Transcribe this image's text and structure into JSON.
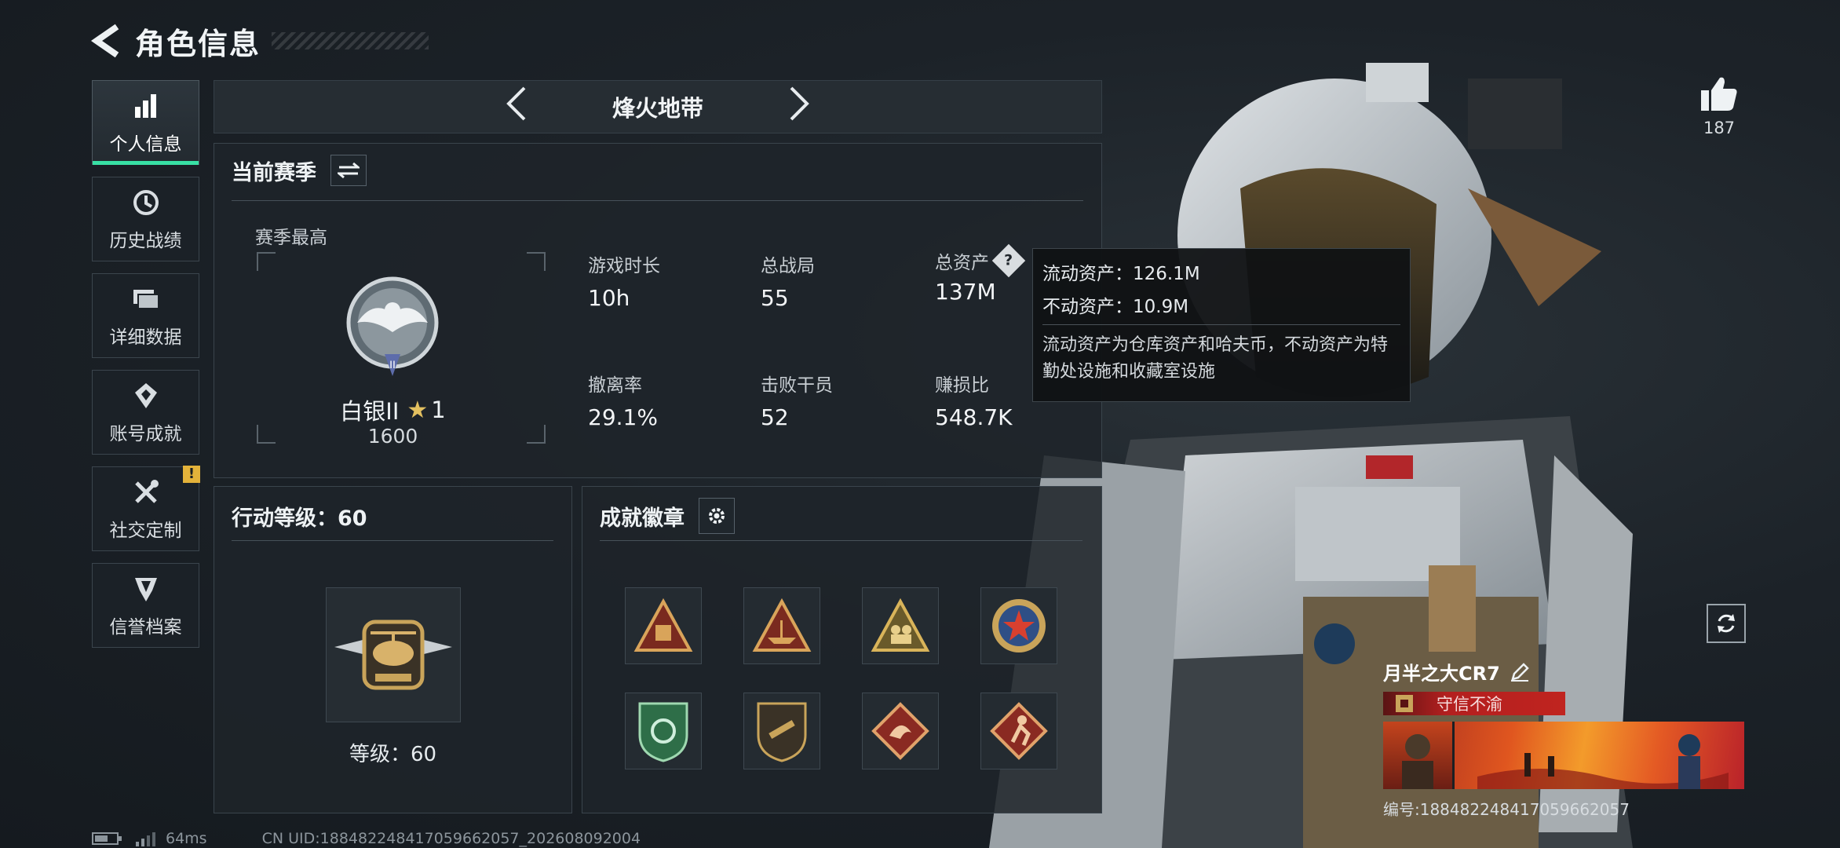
{
  "header": {
    "title": "角色信息"
  },
  "sidebar": {
    "items": [
      {
        "label": "个人信息",
        "active": true
      },
      {
        "label": "历史战绩"
      },
      {
        "label": "详细数据"
      },
      {
        "label": "账号成就"
      },
      {
        "label": "社交定制",
        "badge": "!"
      },
      {
        "label": "信誉档案"
      }
    ]
  },
  "mode_nav": {
    "name": "烽火地带"
  },
  "season": {
    "title": "当前赛季",
    "best_label": "赛季最高",
    "rank_name": "白银II",
    "rank_stars": "1",
    "rank_score": "1600",
    "stats": [
      {
        "label": "游戏时长",
        "value": "10h"
      },
      {
        "label": "总战局",
        "value": "55"
      },
      {
        "label": "总资产",
        "value": "137M"
      },
      {
        "label": "撤离率",
        "value": "29.1%"
      },
      {
        "label": "击败干员",
        "value": "52"
      },
      {
        "label": "赚损比",
        "value": "548.7K"
      }
    ]
  },
  "tooltip": {
    "liquid": "流动资产：126.1M",
    "fixed": "不动资产：10.9M",
    "description": "流动资产为仓库资产和哈夫币，不动资产为特勤处设施和收藏室设施"
  },
  "level": {
    "title": "行动等级：60",
    "label": "等级：60"
  },
  "badges": {
    "title": "成就徽章",
    "medals": [
      "medal-1",
      "medal-2",
      "medal-3",
      "medal-4",
      "medal-5",
      "medal-6",
      "medal-7",
      "medal-8"
    ]
  },
  "likes": {
    "count": "187"
  },
  "player": {
    "name": "月半之大CR7",
    "tag": "守信不渝",
    "id": "编号:188482248417059662057"
  },
  "footer": {
    "ping": "64ms",
    "uid": "CN UID:188482248417059662057_202608092004"
  },
  "colors": {
    "accent": "#38e0a4",
    "alert": "#e3b23a",
    "tag_red": "#c0241f"
  }
}
